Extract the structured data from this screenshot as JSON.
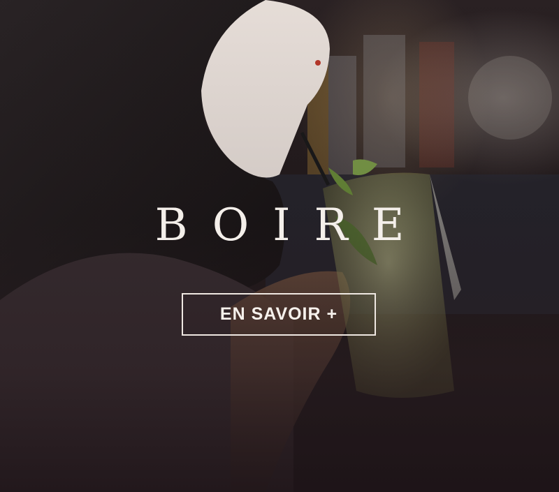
{
  "banner": {
    "title": "BOIRE",
    "cta_label": "EN SAVOIR +",
    "background_image": "woman-drinking-cocktail-photo",
    "colors": {
      "text": "#f4efea",
      "button_border": "#efe8e2"
    }
  }
}
